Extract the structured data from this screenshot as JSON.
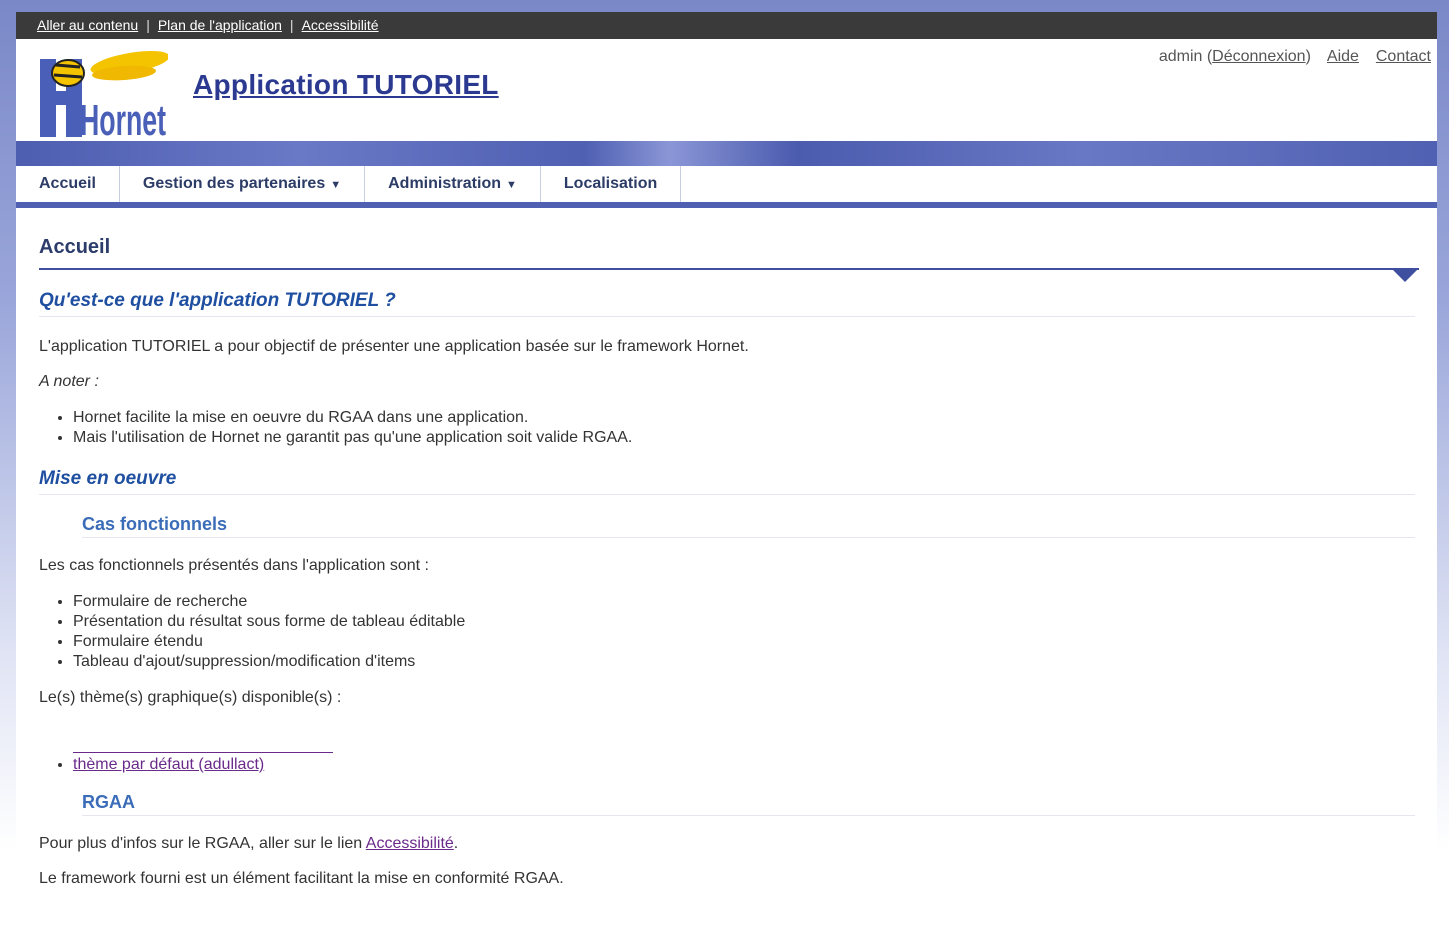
{
  "skiplinks": [
    "Aller au contenu",
    "Plan de l'application",
    "Accessibilité"
  ],
  "header": {
    "logo_text": "Hornet",
    "app_title": "Application TUTORIEL",
    "user": "admin",
    "logout_label": "Déconnexion",
    "help_label": "Aide",
    "contact_label": "Contact"
  },
  "nav": {
    "items": [
      {
        "label": "Accueil"
      },
      {
        "label": "Gestion des partenaires",
        "dropdown": true
      },
      {
        "label": "Administration",
        "dropdown": true
      },
      {
        "label": "Localisation"
      }
    ]
  },
  "main": {
    "page_title": "Accueil",
    "section1": {
      "heading": "Qu'est-ce que l'application TUTORIEL ?",
      "intro": "L'application TUTORIEL a pour objectif de présenter une application basée sur le framework Hornet.",
      "note_label": "A noter :",
      "bullets": [
        "Hornet facilite la mise en oeuvre du RGAA dans une application.",
        "Mais l'utilisation de Hornet ne garantit pas qu'une application soit valide RGAA."
      ]
    },
    "section2": {
      "heading": "Mise en oeuvre",
      "sub1": {
        "heading": "Cas fonctionnels",
        "intro": "Les cas fonctionnels présentés dans l'application sont :",
        "bullets": [
          "Formulaire de recherche",
          "Présentation du résultat sous forme de tableau éditable",
          "Formulaire étendu",
          "Tableau d'ajout/suppression/modification d'items"
        ],
        "themes_label": "Le(s) thème(s) graphique(s) disponible(s) :",
        "theme_link": "thème par défaut (adullact)"
      },
      "sub2": {
        "heading": "RGAA",
        "line1_prefix": "Pour plus d'infos sur le RGAA, aller sur le lien ",
        "line1_link": "Accessibilité",
        "line1_suffix": ".",
        "line2": "Le framework fourni est un élément facilitant la mise en conformité RGAA."
      }
    }
  },
  "colors": {
    "topbar": "#3a3a3a",
    "accent": "#4f5fb2",
    "title": "#2b3a90",
    "heading": "#1f4fa0",
    "subheading": "#3a6cb8"
  }
}
